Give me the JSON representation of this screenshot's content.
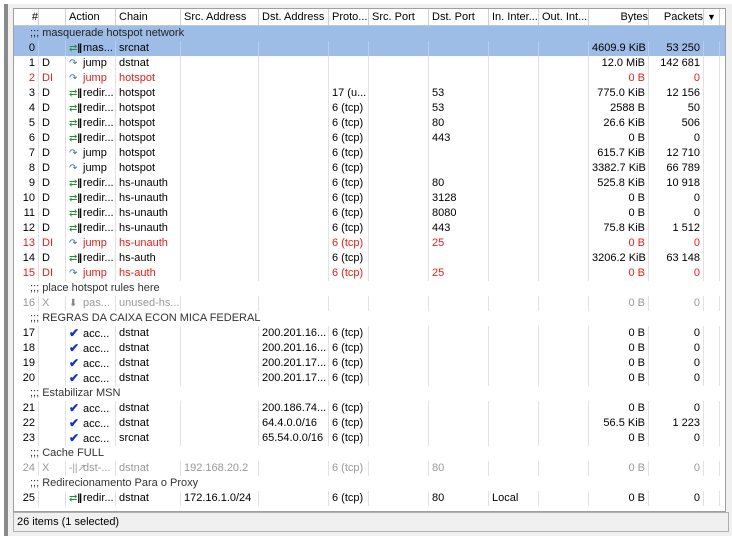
{
  "columns": [
    "#",
    "",
    "Action",
    "Chain",
    "Src. Address",
    "Dst. Address",
    "Proto...",
    "Src. Port",
    "Dst. Port",
    "In. Inter...",
    "Out. Int...",
    "Bytes",
    "Packets"
  ],
  "colors": {
    "selected": "#9dbde6",
    "disabled_invalid": "#e0201a",
    "disabled": "#999999"
  },
  "rows": [
    {
      "type": "comment",
      "text": ";;; masquerade hotspot network",
      "selected": true
    },
    {
      "type": "rule",
      "cells": [
        "0",
        "",
        "mas...",
        "srcnat",
        "",
        "",
        "",
        "",
        "",
        "",
        "",
        "4609.9 KiB",
        "53 250"
      ],
      "icon": "redirect-icon",
      "state": "selected"
    },
    {
      "type": "rule",
      "cells": [
        "1",
        "D",
        "jump",
        "dstnat",
        "",
        "",
        "",
        "",
        "",
        "",
        "",
        "12.0 MiB",
        "142 681"
      ],
      "icon": "jump-icon"
    },
    {
      "type": "rule",
      "cells": [
        "2",
        "DI",
        "jump",
        "hotspot",
        "",
        "",
        "",
        "",
        "",
        "",
        "",
        "0 B",
        "0"
      ],
      "icon": "jump-icon",
      "state": "red"
    },
    {
      "type": "rule",
      "cells": [
        "3",
        "D",
        "redir...",
        "hotspot",
        "",
        "",
        "17 (u...",
        "",
        "53",
        "",
        "",
        "775.0 KiB",
        "12 156"
      ],
      "icon": "redirect-icon"
    },
    {
      "type": "rule",
      "cells": [
        "4",
        "D",
        "redir...",
        "hotspot",
        "",
        "",
        "6 (tcp)",
        "",
        "53",
        "",
        "",
        "2588 B",
        "50"
      ],
      "icon": "redirect-icon"
    },
    {
      "type": "rule",
      "cells": [
        "5",
        "D",
        "redir...",
        "hotspot",
        "",
        "",
        "6 (tcp)",
        "",
        "80",
        "",
        "",
        "26.6 KiB",
        "506"
      ],
      "icon": "redirect-icon"
    },
    {
      "type": "rule",
      "cells": [
        "6",
        "D",
        "redir...",
        "hotspot",
        "",
        "",
        "6 (tcp)",
        "",
        "443",
        "",
        "",
        "0 B",
        "0"
      ],
      "icon": "redirect-icon"
    },
    {
      "type": "rule",
      "cells": [
        "7",
        "D",
        "jump",
        "hotspot",
        "",
        "",
        "6 (tcp)",
        "",
        "",
        "",
        "",
        "615.7 KiB",
        "12 710"
      ],
      "icon": "jump-icon"
    },
    {
      "type": "rule",
      "cells": [
        "8",
        "D",
        "jump",
        "hotspot",
        "",
        "",
        "6 (tcp)",
        "",
        "",
        "",
        "",
        "3382.7 KiB",
        "66 789"
      ],
      "icon": "jump-icon"
    },
    {
      "type": "rule",
      "cells": [
        "9",
        "D",
        "redir...",
        "hs-unauth",
        "",
        "",
        "6 (tcp)",
        "",
        "80",
        "",
        "",
        "525.8 KiB",
        "10 918"
      ],
      "icon": "redirect-icon"
    },
    {
      "type": "rule",
      "cells": [
        "10",
        "D",
        "redir...",
        "hs-unauth",
        "",
        "",
        "6 (tcp)",
        "",
        "3128",
        "",
        "",
        "0 B",
        "0"
      ],
      "icon": "redirect-icon"
    },
    {
      "type": "rule",
      "cells": [
        "11",
        "D",
        "redir...",
        "hs-unauth",
        "",
        "",
        "6 (tcp)",
        "",
        "8080",
        "",
        "",
        "0 B",
        "0"
      ],
      "icon": "redirect-icon"
    },
    {
      "type": "rule",
      "cells": [
        "12",
        "D",
        "redir...",
        "hs-unauth",
        "",
        "",
        "6 (tcp)",
        "",
        "443",
        "",
        "",
        "75.8 KiB",
        "1 512"
      ],
      "icon": "redirect-icon"
    },
    {
      "type": "rule",
      "cells": [
        "13",
        "DI",
        "jump",
        "hs-unauth",
        "",
        "",
        "6 (tcp)",
        "",
        "25",
        "",
        "",
        "0 B",
        "0"
      ],
      "icon": "jump-icon",
      "state": "red"
    },
    {
      "type": "rule",
      "cells": [
        "14",
        "D",
        "redir...",
        "hs-auth",
        "",
        "",
        "6 (tcp)",
        "",
        "",
        "",
        "",
        "3206.2 KiB",
        "63 148"
      ],
      "icon": "redirect-icon"
    },
    {
      "type": "rule",
      "cells": [
        "15",
        "DI",
        "jump",
        "hs-auth",
        "",
        "",
        "6 (tcp)",
        "",
        "25",
        "",
        "",
        "0 B",
        "0"
      ],
      "icon": "jump-icon",
      "state": "red"
    },
    {
      "type": "comment",
      "text": ";;; place hotspot rules here"
    },
    {
      "type": "rule",
      "cells": [
        "16",
        "X",
        "pas...",
        "unused-hs...",
        "",
        "",
        "",
        "",
        "",
        "",
        "",
        "0 B",
        "0"
      ],
      "icon": "passthrough-icon",
      "state": "dis"
    },
    {
      "type": "comment",
      "text": ";;; REGRAS DA CAIXA ECON MICA FEDERAL"
    },
    {
      "type": "rule",
      "cells": [
        "17",
        "",
        "acc...",
        "dstnat",
        "",
        "200.201.16...",
        "6 (tcp)",
        "",
        "",
        "",
        "",
        "0 B",
        "0"
      ],
      "icon": "accept-icon"
    },
    {
      "type": "rule",
      "cells": [
        "18",
        "",
        "acc...",
        "dstnat",
        "",
        "200.201.16...",
        "6 (tcp)",
        "",
        "",
        "",
        "",
        "0 B",
        "0"
      ],
      "icon": "accept-icon"
    },
    {
      "type": "rule",
      "cells": [
        "19",
        "",
        "acc...",
        "dstnat",
        "",
        "200.201.17...",
        "6 (tcp)",
        "",
        "",
        "",
        "",
        "0 B",
        "0"
      ],
      "icon": "accept-icon"
    },
    {
      "type": "rule",
      "cells": [
        "20",
        "",
        "acc...",
        "dstnat",
        "",
        "200.201.17...",
        "6 (tcp)",
        "",
        "",
        "",
        "",
        "0 B",
        "0"
      ],
      "icon": "accept-icon"
    },
    {
      "type": "comment",
      "text": ";;; Estabilizar MSN"
    },
    {
      "type": "rule",
      "cells": [
        "21",
        "",
        "acc...",
        "dstnat",
        "",
        "200.186.74...",
        "6 (tcp)",
        "",
        "",
        "",
        "",
        "0 B",
        "0"
      ],
      "icon": "accept-icon"
    },
    {
      "type": "rule",
      "cells": [
        "22",
        "",
        "acc...",
        "dstnat",
        "",
        "64.4.0.0/16",
        "6 (tcp)",
        "",
        "",
        "",
        "",
        "56.5 KiB",
        "1 223"
      ],
      "icon": "accept-icon"
    },
    {
      "type": "rule",
      "cells": [
        "23",
        "",
        "acc...",
        "srcnat",
        "",
        "65.54.0.0/16",
        "6 (tcp)",
        "",
        "",
        "",
        "",
        "0 B",
        "0"
      ],
      "icon": "accept-icon"
    },
    {
      "type": "comment",
      "text": ";;; Cache  FULL"
    },
    {
      "type": "rule",
      "cells": [
        "24",
        "X",
        "dst-...",
        "dstnat",
        "192.168.20.2",
        "",
        "6 (tcp)",
        "",
        "80",
        "",
        "",
        "0 B",
        "0"
      ],
      "icon": "dst-nat-icon",
      "state": "dis"
    },
    {
      "type": "comment",
      "text": ";;; Redirecionamento Para o Proxy"
    },
    {
      "type": "rule",
      "cells": [
        "25",
        "",
        "redir...",
        "dstnat",
        "172.16.1.0/24",
        "",
        "6 (tcp)",
        "",
        "80",
        "Local",
        "",
        "0 B",
        "0"
      ],
      "icon": "redirect-icon"
    }
  ],
  "status": "26 items (1 selected)"
}
